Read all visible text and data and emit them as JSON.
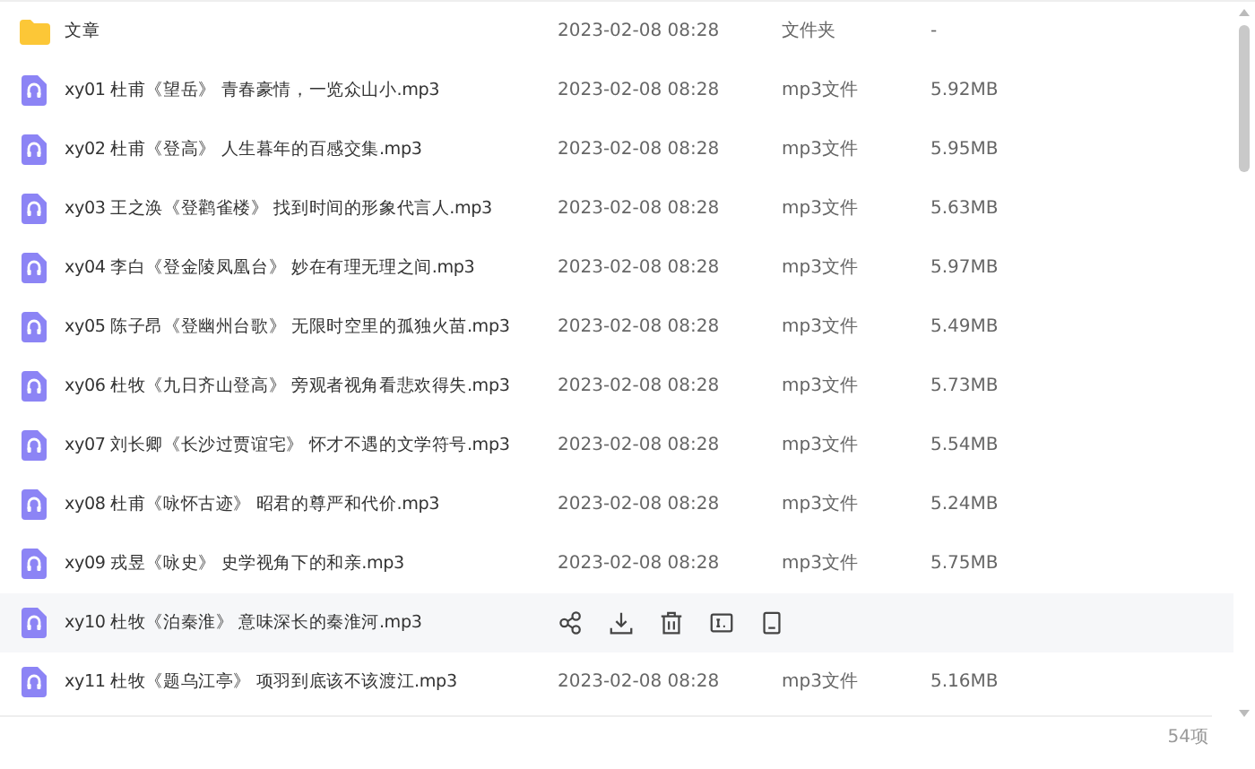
{
  "files": [
    {
      "kind": "folder",
      "name": "文章",
      "date": "2023-02-08 08:28",
      "type": "文件夹",
      "size": "-",
      "hovered": false
    },
    {
      "kind": "audio",
      "name": "xy01 杜甫《望岳》 青春豪情，一览众山小.mp3",
      "date": "2023-02-08 08:28",
      "type": "mp3文件",
      "size": "5.92MB",
      "hovered": false
    },
    {
      "kind": "audio",
      "name": "xy02 杜甫《登高》 人生暮年的百感交集.mp3",
      "date": "2023-02-08 08:28",
      "type": "mp3文件",
      "size": "5.95MB",
      "hovered": false
    },
    {
      "kind": "audio",
      "name": "xy03 王之涣《登鹳雀楼》 找到时间的形象代言人.mp3",
      "date": "2023-02-08 08:28",
      "type": "mp3文件",
      "size": "5.63MB",
      "hovered": false
    },
    {
      "kind": "audio",
      "name": "xy04 李白《登金陵凤凰台》 妙在有理无理之间.mp3",
      "date": "2023-02-08 08:28",
      "type": "mp3文件",
      "size": "5.97MB",
      "hovered": false
    },
    {
      "kind": "audio",
      "name": "xy05 陈子昂《登幽州台歌》 无限时空里的孤独火苗.mp3",
      "date": "2023-02-08 08:28",
      "type": "mp3文件",
      "size": "5.49MB",
      "hovered": false
    },
    {
      "kind": "audio",
      "name": "xy06 杜牧《九日齐山登高》 旁观者视角看悲欢得失.mp3",
      "date": "2023-02-08 08:28",
      "type": "mp3文件",
      "size": "5.73MB",
      "hovered": false
    },
    {
      "kind": "audio",
      "name": "xy07 刘长卿《长沙过贾谊宅》 怀才不遇的文学符号.mp3",
      "date": "2023-02-08 08:28",
      "type": "mp3文件",
      "size": "5.54MB",
      "hovered": false
    },
    {
      "kind": "audio",
      "name": "xy08 杜甫《咏怀古迹》 昭君的尊严和代价.mp3",
      "date": "2023-02-08 08:28",
      "type": "mp3文件",
      "size": "5.24MB",
      "hovered": false
    },
    {
      "kind": "audio",
      "name": "xy09 戎昱《咏史》 史学视角下的和亲.mp3",
      "date": "2023-02-08 08:28",
      "type": "mp3文件",
      "size": "5.75MB",
      "hovered": false
    },
    {
      "kind": "audio",
      "name": "xy10 杜牧《泊秦淮》 意味深长的秦淮河.mp3",
      "hovered": true
    },
    {
      "kind": "audio",
      "name": "xy11 杜牧《题乌江亭》 项羽到底该不该渡江.mp3",
      "date": "2023-02-08 08:28",
      "type": "mp3文件",
      "size": "5.16MB",
      "hovered": false
    }
  ],
  "footer": {
    "count": "54项"
  }
}
